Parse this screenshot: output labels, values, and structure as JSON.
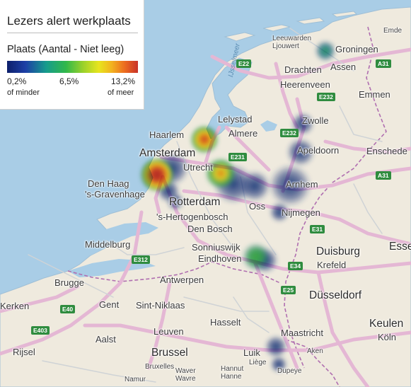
{
  "legend": {
    "title": "Lezers alert werkplaats",
    "subtitle": "Plaats (Aantal - Niet leeg)",
    "min_value": "0,2%",
    "mid_value": "6,5%",
    "max_value": "13,2%",
    "min_note": "of minder",
    "max_note": "of meer"
  },
  "map": {
    "cities": [
      "Amsterdam",
      "Rotterdam",
      "Den Haag",
      "'s-Gravenhage",
      "Haarlem",
      "Utrecht",
      "Almere",
      "Lelystad",
      "Zwolle",
      "Apeldoorn",
      "Arnhem",
      "Nijmegen",
      "Oss",
      "'s-Hertogenbosch",
      "Den Bosch",
      "Eindhoven",
      "Sonniuswijk",
      "Middelburg",
      "Antwerpen",
      "Brugge",
      "Gent",
      "Sint-Niklaas",
      "Aalst",
      "Brussel",
      "Leuven",
      "Hasselt",
      "Luik",
      "Maastricht",
      "Düsseldorf",
      "Duisburg",
      "Krefeld",
      "Keulen",
      "Köln",
      "Enschede",
      "Emmen",
      "Assen",
      "Groningen",
      "Leeuwarden",
      "Ljouwert",
      "Drachten",
      "Heerenveen",
      "Rijsel",
      "Essen",
      "Emde",
      "Aken",
      "Kerken",
      "Bruxelles",
      "Liège",
      "Dupeye",
      "Waver",
      "Wavre",
      "Hannut",
      "Hanne",
      "Namur"
    ],
    "water": [
      "IJsselmeer"
    ],
    "roads": [
      "E22",
      "E232",
      "E231",
      "A31",
      "E312",
      "E31",
      "E34",
      "E25",
      "E40",
      "E403"
    ],
    "heat_spots": [
      {
        "place": "Den Haag",
        "intensity": 13.2,
        "color": "#c8322a"
      },
      {
        "place": "Haarlem",
        "intensity": 10.8,
        "color": "#e65a21"
      },
      {
        "place": "Utrecht",
        "intensity": 9.5,
        "color": "#ee9a22"
      },
      {
        "place": "Eindhoven",
        "intensity": 4.5,
        "color": "#39b54a"
      },
      {
        "place": "Groningen",
        "intensity": 3.4,
        "color": "#1f9c7a"
      },
      {
        "place": "Apeldoorn",
        "intensity": 1.6,
        "color": "#1d4ea0"
      },
      {
        "place": "Arnhem",
        "intensity": 1.6,
        "color": "#1d4ea0"
      },
      {
        "place": "Luik",
        "intensity": 1.2,
        "color": "#1d3f8a"
      },
      {
        "place": "Maastricht",
        "intensity": 1.2,
        "color": "#1d3f8a"
      },
      {
        "place": "Zwolle",
        "intensity": 0.8,
        "color": "#22408a"
      },
      {
        "place": "Rotterdam",
        "intensity": 0.8,
        "color": "#22408a"
      }
    ]
  }
}
